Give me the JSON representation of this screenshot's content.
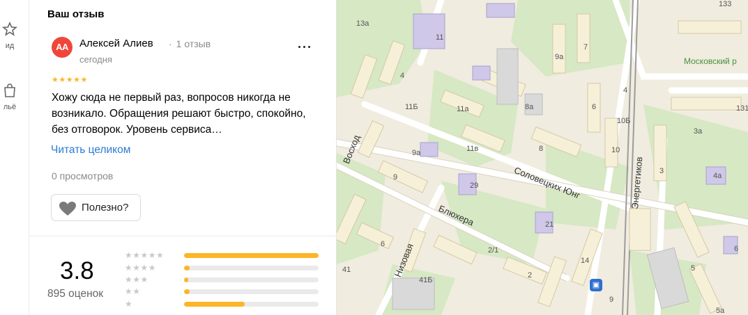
{
  "left_nav": {
    "items": [
      {
        "label": "ид",
        "icon": "star-icon"
      },
      {
        "label": "льё",
        "icon": "bag-icon"
      }
    ]
  },
  "review_section": {
    "title": "Ваш отзыв",
    "author": {
      "initials": "AA",
      "name": "Алексей Алиев",
      "reviews_count": "1 отзыв",
      "separator": "·",
      "date": "сегодня",
      "avatar_color": "#f0463a"
    },
    "stars": "★★★★★",
    "rating": 5,
    "text": "Хожу сюда не первый раз, вопросов никогда не возникало. Обращения решают быстро, спокойно, без отговорок. Уровень сервиса…",
    "read_more": "Читать целиком",
    "views": "0 просмотров",
    "useful_button": "Полезно?"
  },
  "rating_summary": {
    "value": "3.8",
    "count": "895 оценок",
    "distribution": [
      {
        "stars": "★★★★★",
        "fraction": 1.0
      },
      {
        "stars": "★★★★",
        "fraction": 0.04
      },
      {
        "stars": "★★★",
        "fraction": 0.03
      },
      {
        "stars": "★★",
        "fraction": 0.04
      },
      {
        "stars": "★",
        "fraction": 0.45
      }
    ],
    "accent_color": "#fcb527"
  },
  "map": {
    "streets": [
      "Соловецких Юнг",
      "Блюхера",
      "Восход",
      "Низовая",
      "Энергетиков"
    ],
    "park": "Московский р",
    "house_numbers": [
      "13а",
      "11",
      "7",
      "9а",
      "133",
      "4",
      "4",
      "11Б",
      "11а",
      "8а",
      "6",
      "131",
      "10Б",
      "3а",
      "Восход",
      "9а",
      "11в",
      "8",
      "10",
      "3",
      "4а",
      "9",
      "29",
      "21",
      "6",
      "6",
      "2/1",
      "14",
      "41",
      "41Б",
      "2",
      "5",
      "9",
      "5а"
    ]
  }
}
